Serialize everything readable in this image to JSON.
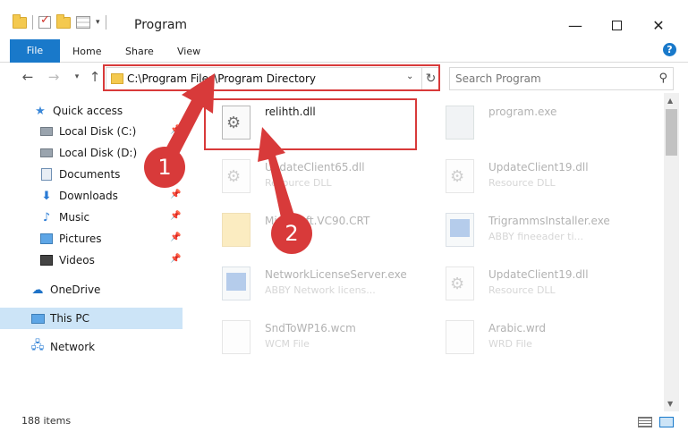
{
  "window": {
    "title": "Program",
    "controls": {
      "minimize": "—",
      "maximize": "",
      "close": "✕"
    }
  },
  "ribbon": {
    "tabs": [
      "File",
      "Home",
      "Share",
      "View"
    ],
    "help": "?"
  },
  "address": {
    "path": "C:\\Program Files\\Program Directory"
  },
  "search": {
    "placeholder": "Search Program"
  },
  "sidebar": {
    "items": [
      {
        "label": "Quick access",
        "icon": "star-icon"
      },
      {
        "label": "Local Disk (C:)",
        "icon": "disk-icon",
        "pinned": true
      },
      {
        "label": "Local Disk (D:)",
        "icon": "disk-icon"
      },
      {
        "label": "Documents",
        "icon": "documents-icon",
        "pinned": true
      },
      {
        "label": "Downloads",
        "icon": "downloads-icon",
        "pinned": true
      },
      {
        "label": "Music",
        "icon": "music-icon",
        "pinned": true
      },
      {
        "label": "Pictures",
        "icon": "pictures-icon",
        "pinned": true
      },
      {
        "label": "Videos",
        "icon": "videos-icon",
        "pinned": true
      },
      {
        "label": "OneDrive",
        "icon": "cloud-icon"
      },
      {
        "label": "This PC",
        "icon": "computer-icon",
        "selected": true
      },
      {
        "label": "Network",
        "icon": "network-icon"
      }
    ]
  },
  "files": [
    {
      "name": "relihth.dll",
      "type": "",
      "icon": "dll-gear-icon"
    },
    {
      "name": "program.exe",
      "type": "",
      "icon": "exe-icon"
    },
    {
      "name": "UpdateClient65.dll",
      "type": "Resource DLL",
      "icon": "dll-gear-icon"
    },
    {
      "name": "UpdateClient19.dll",
      "type": "Resource DLL",
      "icon": "dll-gear-icon"
    },
    {
      "name": "Microsoft.VC90.CRT",
      "type": "",
      "icon": "folder-icon"
    },
    {
      "name": "TrigrammsInstaller.exe",
      "type": "ABBY fineeader ti...",
      "icon": "app-icon"
    },
    {
      "name": "NetworkLicenseServer.exe",
      "type": "ABBY Network licens...",
      "icon": "app-icon"
    },
    {
      "name": "UpdateClient19.dll",
      "type": "Resource DLL",
      "icon": "dll-gear-icon"
    },
    {
      "name": "SndToWP16.wcm",
      "type": "WCM File",
      "icon": "blank-file-icon"
    },
    {
      "name": "Arabic.wrd",
      "type": "WRD File",
      "icon": "blank-file-icon"
    }
  ],
  "annotations": [
    "1",
    "2"
  ],
  "status": {
    "count": "188 items"
  },
  "colors": {
    "accent": "#1979ca",
    "highlight": "#d83a3a",
    "selected": "#cce4f7"
  }
}
